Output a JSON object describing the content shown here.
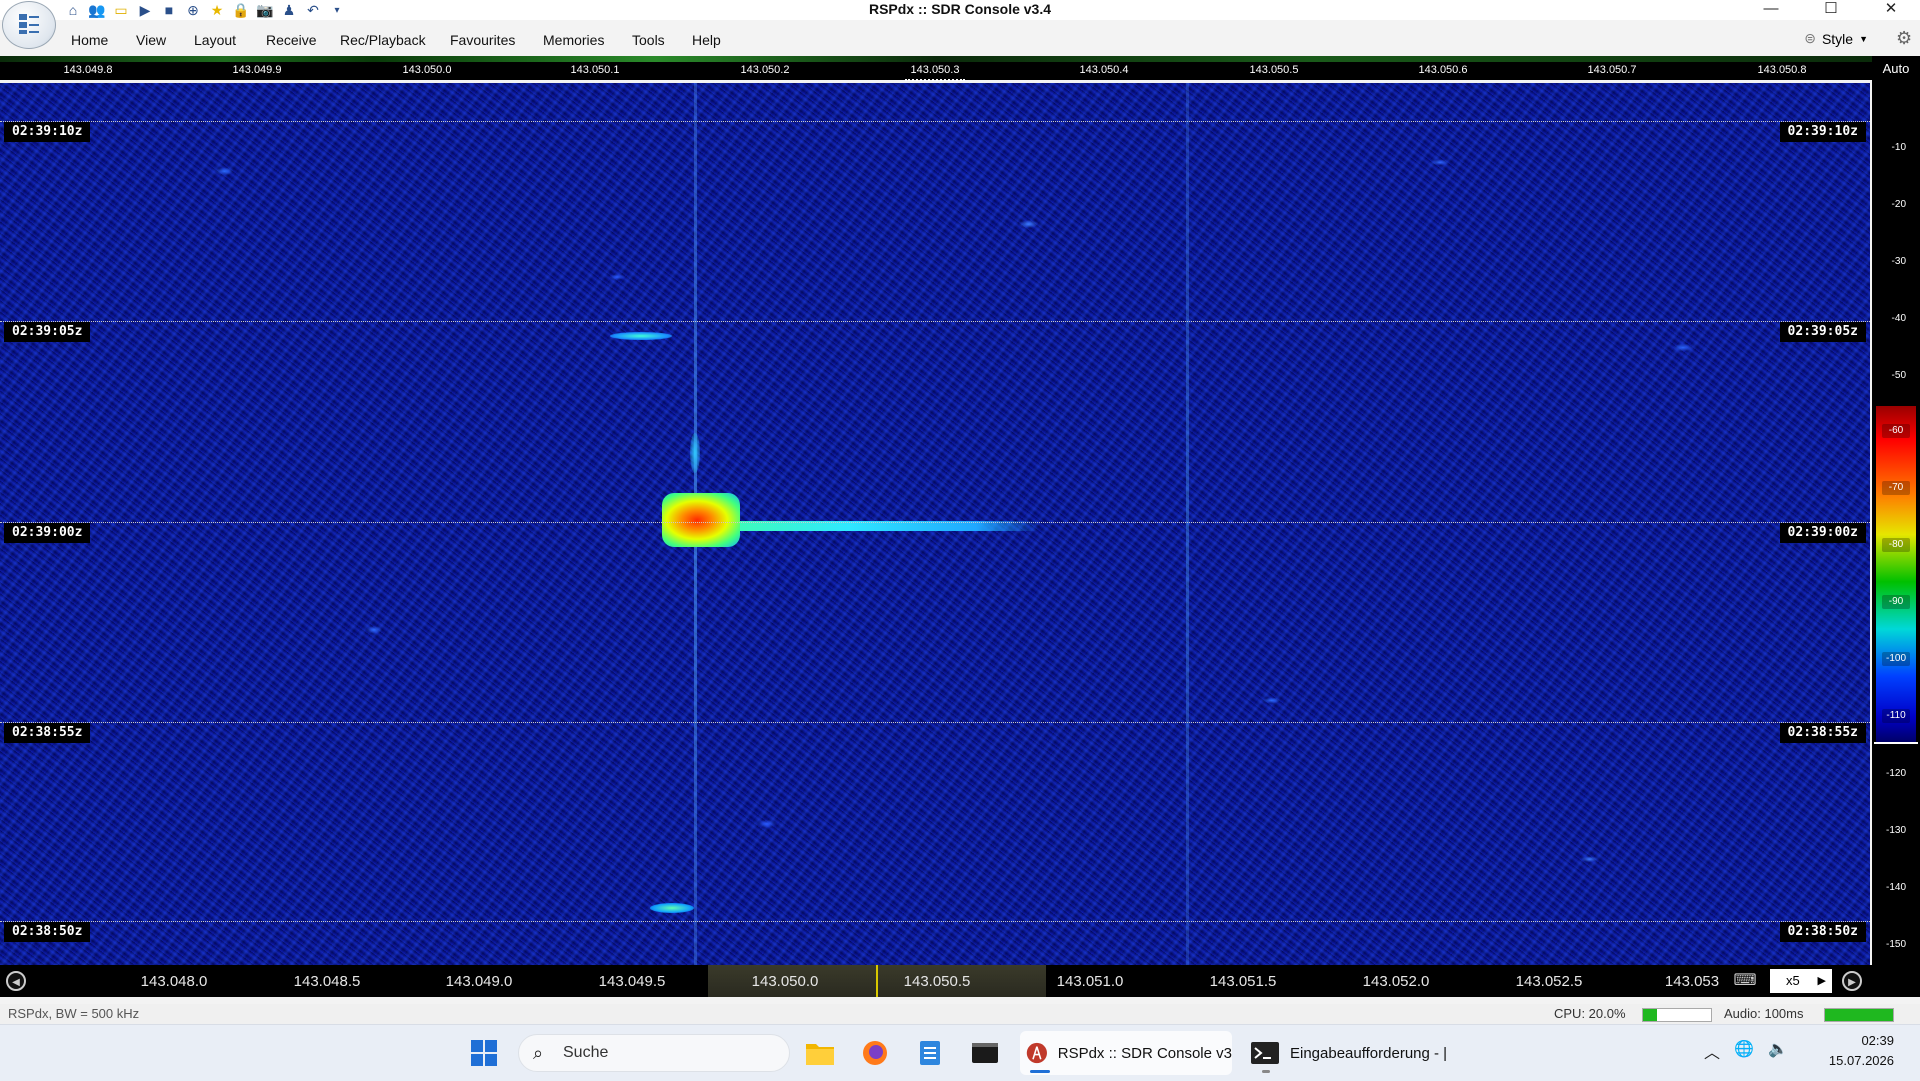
{
  "window": {
    "title": "RSPdx :: SDR Console v3.4",
    "controls": {
      "minimize": "—",
      "maximize": "☐",
      "close": "✕"
    }
  },
  "quick_access": [
    "home-icon",
    "users-icon",
    "folder-icon",
    "play-icon",
    "stop-icon",
    "add-icon",
    "star-icon",
    "lock-icon",
    "camera-icon",
    "user-icon",
    "undo-icon",
    "dropdown-icon"
  ],
  "menu": {
    "items": [
      "Home",
      "View",
      "Layout",
      "Receive",
      "Rec/Playback",
      "Favourites",
      "Memories",
      "Tools",
      "Help"
    ],
    "style_label": "Style"
  },
  "top_ruler": {
    "ticks": [
      "143.049.8",
      "143.049.9",
      "143.050.0",
      "143.050.1",
      "143.050.2",
      "143.050.3",
      "143.050.4",
      "143.050.5",
      "143.050.6",
      "143.050.7",
      "143.050.8"
    ]
  },
  "waterfall": {
    "timestamps": [
      "02:39:10z",
      "02:39:05z",
      "02:39:00z",
      "02:38:55z",
      "02:38:50z"
    ]
  },
  "db_scale": {
    "auto_label": "Auto",
    "ticks": [
      "-10",
      "-20",
      "-30",
      "-40",
      "-50",
      "-120",
      "-130",
      "-140",
      "-150"
    ],
    "colorbar_labels": [
      "-60",
      "-70",
      "-80",
      "-90",
      "-100",
      "-110"
    ]
  },
  "bottom_ruler": {
    "ticks": [
      "143.048.0",
      "143.048.5",
      "143.049.0",
      "143.049.5",
      "143.050.0",
      "143.050.5",
      "143.051.0",
      "143.051.5",
      "143.052.0",
      "143.052.5",
      "143.053"
    ],
    "zoom": "x5"
  },
  "status": {
    "left": "RSPdx, BW = 500 kHz",
    "cpu": "CPU: 20.0%",
    "cpu_level": 0.2,
    "audio": "Audio: 100ms",
    "audio_level": 1.0
  },
  "taskbar": {
    "search_placeholder": "Suche",
    "apps": [
      {
        "label": "RSPdx :: SDR Console v3",
        "active": true
      },
      {
        "label": "Eingabeaufforderung - |",
        "active": false
      }
    ],
    "clock_time": "02:39",
    "clock_date": "15.07.2026"
  },
  "colors": {
    "waterfall_bg": "#061076",
    "signal_core": "#ff3000",
    "signal_trail": "#40ffd0",
    "cpu_bar": "#1fb81f",
    "passband_marker": "#d8c800"
  }
}
